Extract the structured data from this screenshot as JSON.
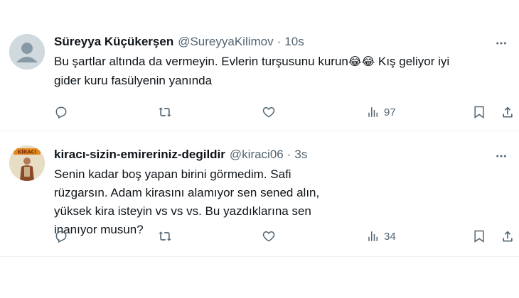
{
  "tweets": [
    {
      "name": "Süreyya Küçükerşen",
      "handle": "@SureyyaKilimov",
      "dot": "·",
      "time": "10s",
      "text_line1": "Bu şartlar altında da vermeyin. Evlerin turşusunu kurun",
      "emoji": "😂😂",
      "text_line1_rest": " Kış geliyor iyi",
      "text_line2": "gider kuru fasülyenin yanında",
      "views": "97",
      "avatar": "default-avatar"
    },
    {
      "name": "kiracı-sizin-emireriniz-degildir",
      "handle": "@kiraci06",
      "dot": "·",
      "time": "3s",
      "text": "Senin kadar boş yapan birini görmedim. Safi rüzgarsın. Adam kirasını alamıyor sen sened alın, yüksek kira isteyin vs vs vs. Bu yazdıklarına sen inanıyor musun?",
      "views": "34",
      "avatar": "kiraci-avatar"
    }
  ],
  "colors": {
    "text": "#0f1419",
    "muted": "#536471",
    "divider": "#eff3f4"
  }
}
